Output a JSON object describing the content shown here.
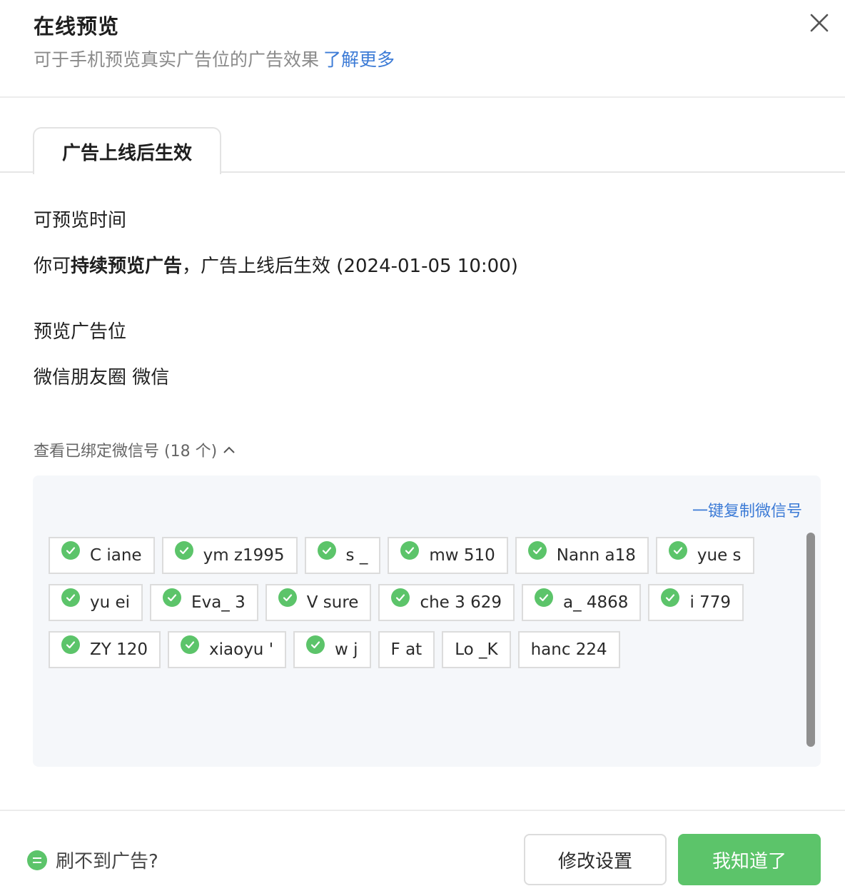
{
  "header": {
    "title": "在线预览",
    "subtitle": "可于手机预览真实广告位的广告效果",
    "learn_more": "了解更多"
  },
  "tab": {
    "label": "广告上线后生效"
  },
  "preview_time": {
    "label": "可预览时间",
    "text_prefix": "你可",
    "text_bold": "持续预览广告",
    "text_suffix": "，广告上线后生效 (2024-01-05 10:00)"
  },
  "placement": {
    "label": "预览广告位",
    "value": "微信朋友圈 微信"
  },
  "bound_accounts": {
    "toggle_label": "查看已绑定微信号 (18 个)",
    "copy_all": "一键复制微信号",
    "accounts": [
      {
        "name": "C  iane",
        "verified": true
      },
      {
        "name": "ym  z1995",
        "verified": true
      },
      {
        "name": "s   _",
        "verified": true
      },
      {
        "name": "mw   510",
        "verified": true
      },
      {
        "name": "Nann  a18",
        "verified": true
      },
      {
        "name": "yue   s",
        "verified": true
      },
      {
        "name": "yu   ei",
        "verified": true
      },
      {
        "name": "Eva_   3",
        "verified": true
      },
      {
        "name": "V  sure",
        "verified": true
      },
      {
        "name": "che  3 629",
        "verified": true
      },
      {
        "name": "a_  4868",
        "verified": true
      },
      {
        "name": "i   779",
        "verified": true
      },
      {
        "name": "ZY  120",
        "verified": true
      },
      {
        "name": "xiaoyu '",
        "verified": true
      },
      {
        "name": "w  j",
        "verified": true
      },
      {
        "name": "F  at",
        "verified": false
      },
      {
        "name": "Lo  _K",
        "verified": false
      },
      {
        "name": "hanc  224",
        "verified": false
      }
    ]
  },
  "footer": {
    "help": "刷不到广告?",
    "modify": "修改设置",
    "confirm": "我知道了"
  },
  "colors": {
    "accent_green": "#5cc46a",
    "link_blue": "#3c7bd6"
  }
}
